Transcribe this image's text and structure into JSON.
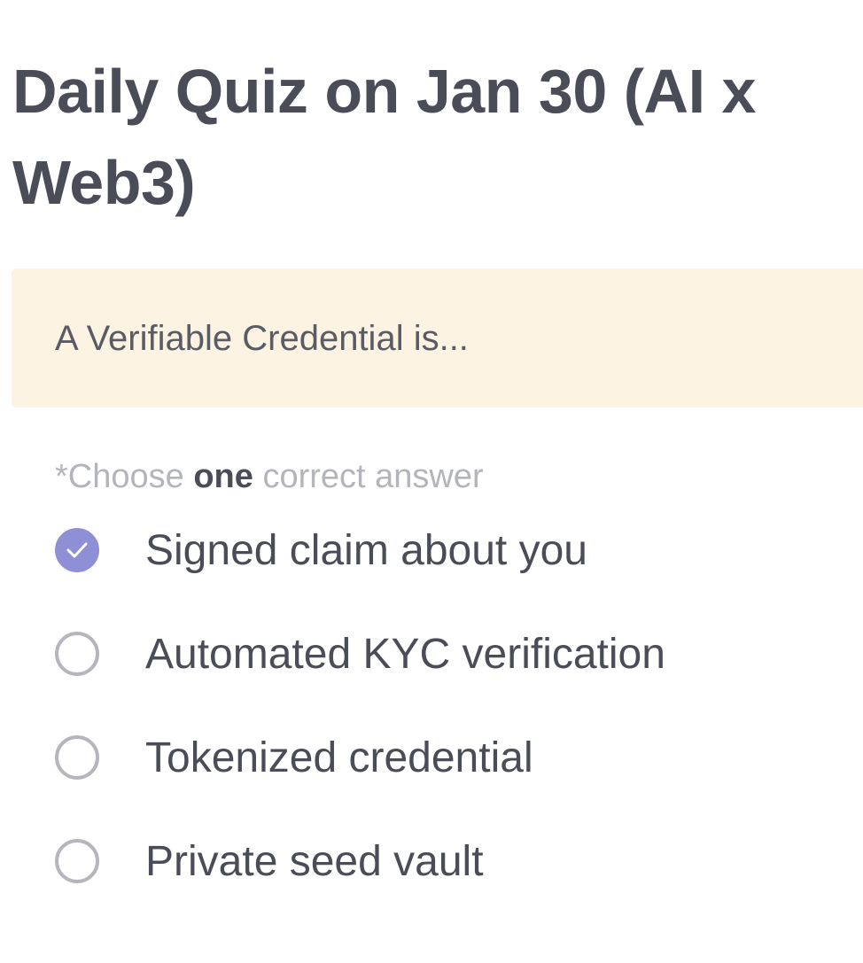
{
  "quiz": {
    "title": "Daily Quiz on Jan 30 (AI x Web3)",
    "question": "A Verifiable Credential is...",
    "instruction": {
      "prefix": "*Choose ",
      "emphasis": "one",
      "suffix": " correct answer"
    },
    "options": [
      {
        "label": "Signed claim about you",
        "selected": true
      },
      {
        "label": "Automated KYC verification",
        "selected": false
      },
      {
        "label": "Tokenized credential",
        "selected": false
      },
      {
        "label": "Private seed vault",
        "selected": false
      }
    ]
  },
  "colors": {
    "text": "#4a4d57",
    "question_bg": "#fdf3e3",
    "accent": "#8f8fd6",
    "muted": "#b3b5bb"
  },
  "icons": {
    "selected": "check-icon",
    "unselected": "radio-empty-icon"
  }
}
